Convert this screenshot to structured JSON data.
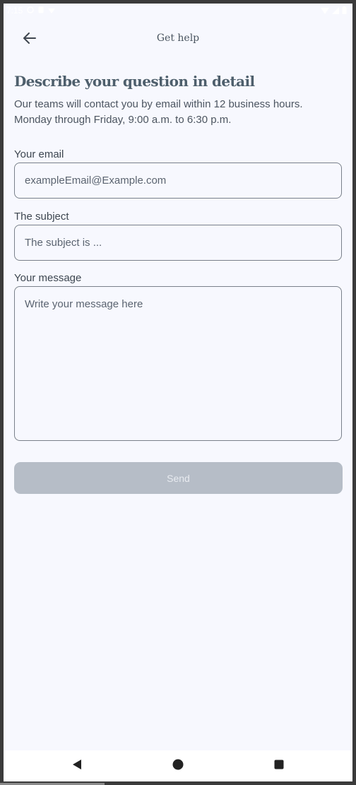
{
  "status_bar": {
    "time": "7:15"
  },
  "app_bar": {
    "title": "Get help"
  },
  "main": {
    "heading": "Describe your question in detail",
    "description_line1": "Our teams will contact you by email within 12 business hours.",
    "description_line2": "Monday through Friday, 9:00 a.m. to 6:30 p.m."
  },
  "form": {
    "email_label": "Your email",
    "email_placeholder": "exampleEmail@Example.com",
    "subject_label": "The subject",
    "subject_placeholder": "The subject is ...",
    "message_label": "Your message",
    "message_placeholder": "Write your message here",
    "send_label": "Send"
  },
  "icons": {
    "back": "arrow-left-icon",
    "nav_back": "triangle-back-icon",
    "nav_home": "circle-home-icon",
    "nav_recents": "square-recents-icon"
  },
  "colors": {
    "background": "#f7f8fe",
    "heading": "#4e5f6c",
    "send_disabled": "#b6bdc7",
    "input_border": "#79808a"
  }
}
